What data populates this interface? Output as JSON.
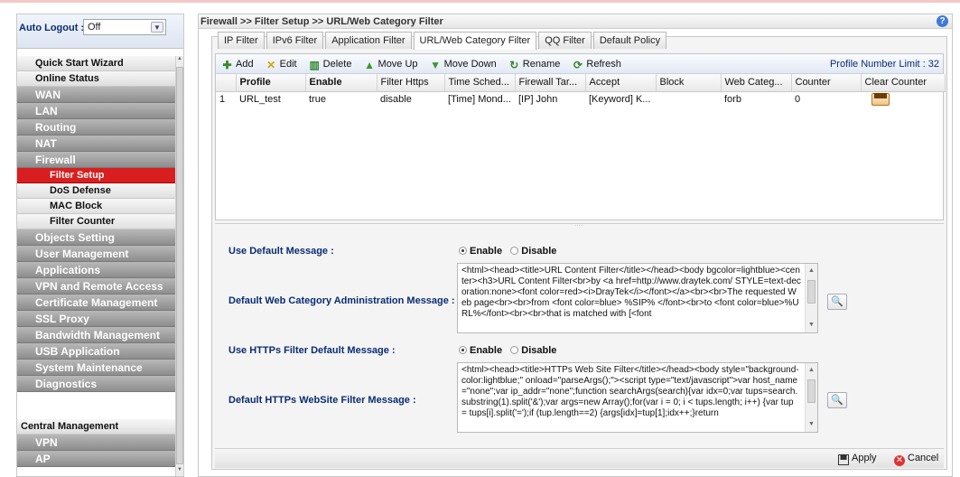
{
  "auto_logout": {
    "label": "Auto Logout :",
    "value": "Off"
  },
  "menu": {
    "quick_start": "Quick Start Wizard",
    "online_status": "Online Status",
    "wan": "WAN",
    "lan": "LAN",
    "routing": "Routing",
    "nat": "NAT",
    "firewall": "Firewall",
    "filter_setup": "Filter Setup",
    "dos_defense": "DoS Defense",
    "mac_block": "MAC Block",
    "filter_counter": "Filter Counter",
    "objects_setting": "Objects Setting",
    "user_management": "User Management",
    "applications": "Applications",
    "vpn_remote": "VPN and Remote Access",
    "cert_mgmt": "Certificate Management",
    "ssl_proxy": "SSL Proxy",
    "bandwidth": "Bandwidth Management",
    "usb_app": "USB Application",
    "sys_maint": "System Maintenance",
    "diagnostics": "Diagnostics",
    "central_mgmt": "Central Management",
    "vpn": "VPN",
    "ap": "AP"
  },
  "breadcrumb": "Firewall >> Filter Setup >> URL/Web Category Filter",
  "tabs": [
    "IP Filter",
    "IPv6 Filter",
    "Application Filter",
    "URL/Web Category Filter",
    "QQ Filter",
    "Default Policy"
  ],
  "toolbar": {
    "add": "Add",
    "edit": "Edit",
    "delete": "Delete",
    "move_up": "Move Up",
    "move_down": "Move Down",
    "rename": "Rename",
    "refresh": "Refresh",
    "profile_limit": "Profile Number Limit : 32"
  },
  "table": {
    "headers": [
      "",
      "Profile",
      "Enable",
      "Filter Https",
      "Time Sched...",
      "Firewall Tar...",
      "Accept",
      "Block",
      "Web Categ...",
      "Counter",
      "Clear Counter"
    ],
    "rows": [
      [
        "1",
        "URL_test",
        "true",
        "disable",
        "[Time] Mond...",
        "[IP] John",
        "[Keyword] K...",
        "",
        "forb",
        "0",
        ""
      ]
    ]
  },
  "form": {
    "use_default_msg_label": "Use Default Message :",
    "enable": "Enable",
    "disable": "Disable",
    "web_cat_msg_label": "Default Web Category Administration Message :",
    "web_cat_msg": "<html><head><title>URL Content Filter</title></head><body bgcolor=lightblue><center><h3>URL Content Filter<br>by <a href=http://www.draytek.com/ STYLE=text-decoration:none><font color=red><i>DrayTek</i></font></a><br><br>The requested Web page<br><br>from <font color=blue> %SIP% </font><br>to <font color=blue>%URL%</font><br><br>that is matched with [<font",
    "use_https_default_label": "Use HTTPs Filter Default Message :",
    "https_msg_label": "Default HTTPs WebSite Filter Message :",
    "https_msg": "<html><head><title>HTTPs Web Site Filter</title></head><body style=\"background-color:lightblue;\" onload=\"parseArgs();\"><script type=\"text/javascript\">var host_name=\"none\";var ip_addr=\"none\";function searchArgs(search){var idx=0;var tups=search.substring(1).split('&');var args=new Array();for(var i = 0; i < tups.length; i++) {var tup = tups[i].split('=');if (tup.length==2) {args[idx]=tup[1];idx++;}return"
  },
  "footer": {
    "apply": "Apply",
    "cancel": "Cancel"
  }
}
